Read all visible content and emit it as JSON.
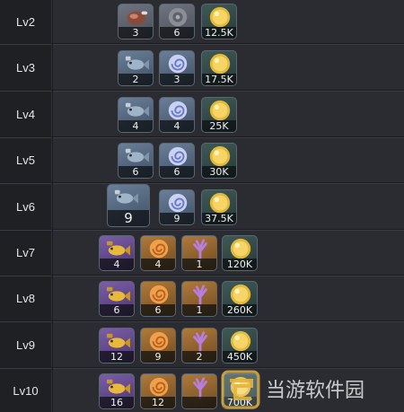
{
  "rows": [
    {
      "level": "Lv2",
      "items": [
        {
          "icon": "meat-icon",
          "qty": "3",
          "bg": "gray"
        },
        {
          "icon": "shell-icon",
          "qty": "6",
          "bg": "gray"
        },
        {
          "icon": "coin-icon",
          "qty": "12.5K",
          "bg": "gold"
        }
      ]
    },
    {
      "level": "Lv3",
      "items": [
        {
          "icon": "fish-icon",
          "qty": "2",
          "bg": "blue"
        },
        {
          "icon": "blue-shell-icon",
          "qty": "3",
          "bg": "blue"
        },
        {
          "icon": "coin-icon",
          "qty": "17.5K",
          "bg": "gold"
        }
      ]
    },
    {
      "level": "Lv4",
      "items": [
        {
          "icon": "fish-icon",
          "qty": "4",
          "bg": "blue"
        },
        {
          "icon": "blue-shell-icon",
          "qty": "4",
          "bg": "blue"
        },
        {
          "icon": "coin-icon",
          "qty": "25K",
          "bg": "gold"
        }
      ]
    },
    {
      "level": "Lv5",
      "items": [
        {
          "icon": "fish-icon",
          "qty": "6",
          "bg": "blue"
        },
        {
          "icon": "blue-shell-icon",
          "qty": "6",
          "bg": "blue"
        },
        {
          "icon": "coin-icon",
          "qty": "30K",
          "bg": "gold"
        }
      ]
    },
    {
      "level": "Lv6",
      "items": [
        {
          "icon": "fish-icon",
          "qty": "9",
          "bg": "blue"
        },
        {
          "icon": "blue-shell-icon",
          "qty": "9",
          "bg": "blue"
        },
        {
          "icon": "coin-icon",
          "qty": "37.5K",
          "bg": "gold"
        }
      ]
    },
    {
      "level": "Lv7",
      "items": [
        {
          "icon": "gold-fish-icon",
          "qty": "4",
          "bg": "purple"
        },
        {
          "icon": "orange-shell-icon",
          "qty": "4",
          "bg": "orange"
        },
        {
          "icon": "coral-icon",
          "qty": "1",
          "bg": "orange"
        },
        {
          "icon": "coin-icon",
          "qty": "120K",
          "bg": "gold"
        }
      ]
    },
    {
      "level": "Lv8",
      "items": [
        {
          "icon": "gold-fish-icon",
          "qty": "6",
          "bg": "purple"
        },
        {
          "icon": "orange-shell-icon",
          "qty": "6",
          "bg": "orange"
        },
        {
          "icon": "coral-icon",
          "qty": "1",
          "bg": "orange"
        },
        {
          "icon": "coin-icon",
          "qty": "260K",
          "bg": "gold"
        }
      ]
    },
    {
      "level": "Lv9",
      "items": [
        {
          "icon": "gold-fish-icon",
          "qty": "12",
          "bg": "purple"
        },
        {
          "icon": "orange-shell-icon",
          "qty": "9",
          "bg": "orange"
        },
        {
          "icon": "coral-icon",
          "qty": "2",
          "bg": "orange"
        },
        {
          "icon": "coin-icon",
          "qty": "450K",
          "bg": "gold"
        }
      ]
    },
    {
      "level": "Lv10",
      "items": [
        {
          "icon": "gold-fish-icon",
          "qty": "16",
          "bg": "purple"
        },
        {
          "icon": "orange-shell-icon",
          "qty": "12",
          "bg": "orange"
        },
        {
          "icon": "coral-icon",
          "qty": "",
          "bg": "orange"
        },
        {
          "icon": "coin-icon",
          "qty": "700K",
          "bg": "gold"
        }
      ]
    }
  ],
  "watermark": {
    "text": "当游软件园",
    "url": "www.downxia.com"
  }
}
